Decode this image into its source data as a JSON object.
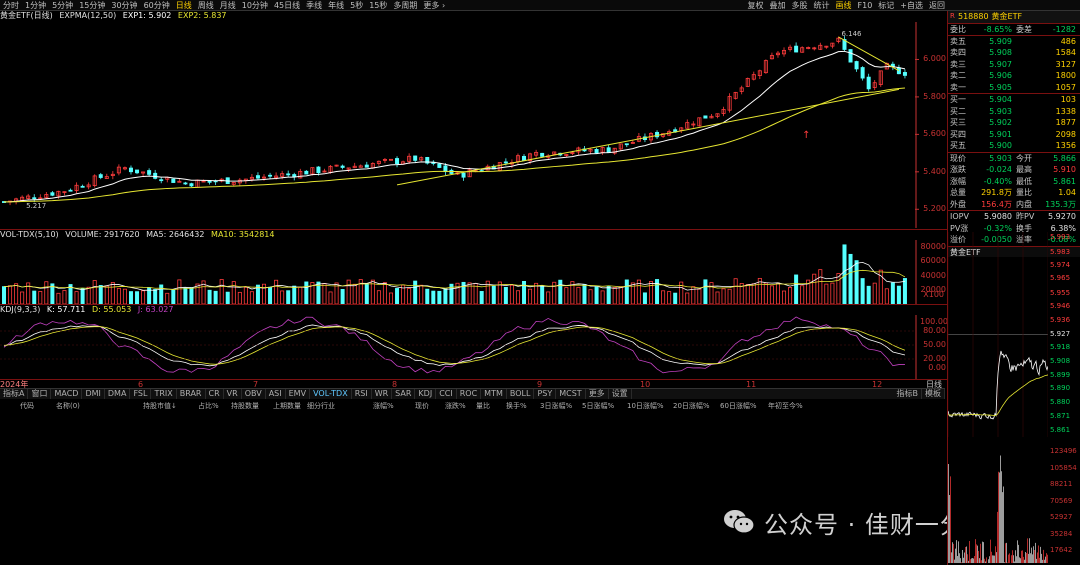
{
  "toolbar": {
    "periods": [
      "分时",
      "1分钟",
      "5分钟",
      "15分钟",
      "30分钟",
      "60分钟",
      "日线",
      "周线",
      "月线",
      "10分钟",
      "45日线",
      "季线",
      "年线",
      "5秒",
      "15秒",
      "多周期",
      "更多 ›"
    ],
    "active_period": "日线",
    "right_tools": [
      "复权",
      "叠加",
      "多股",
      "统计",
      "画线",
      "F10",
      "标记",
      "+自选",
      "返回"
    ]
  },
  "main_chart": {
    "title": "黄金ETF(日线)",
    "indicator": "EXPMA(12,50)",
    "exp1": "EXP1: 5.902",
    "exp2": "EXP2: 5.837",
    "y_ticks": [
      "6.000",
      "5.800",
      "5.600",
      "5.400",
      "5.200"
    ],
    "high_mark": "6.146",
    "low_mark": "5.217"
  },
  "vol_chart": {
    "indicator": "VOL-TDX(5,10)",
    "volume": "VOLUME: 2917620",
    "ma5": "MA5: 2646432",
    "ma10": "MA10: 3542814",
    "y_ticks": [
      "80000",
      "60000",
      "40000",
      "20000"
    ],
    "unit": "X100"
  },
  "kdj_chart": {
    "indicator": "KDJ(9,3,3)",
    "k": "K: 57.711",
    "d": "D: 55.053",
    "j": "J: 63.027",
    "y_ticks": [
      "100.00",
      "80.00",
      "50.00",
      "20.00",
      "0.00"
    ]
  },
  "x_axis": {
    "labels": [
      "2024年",
      "6",
      "7",
      "8",
      "9",
      "10",
      "11",
      "12"
    ],
    "right_label": "日线"
  },
  "tabs": [
    "指标A",
    "窗口",
    "MACD",
    "DMI",
    "DMA",
    "FSL",
    "TRIX",
    "BRAR",
    "CR",
    "VR",
    "OBV",
    "ASI",
    "EMV",
    "VOL-TDX",
    "RSI",
    "WR",
    "SAR",
    "KDJ",
    "CCI",
    "ROC",
    "MTM",
    "BOLL",
    "PSY",
    "MCST",
    "更多",
    "设置"
  ],
  "active_tab": "VOL-TDX",
  "tabs_right": [
    "指标B",
    "模板"
  ],
  "columns": [
    "代码",
    "名称(0)",
    "持股市值↓",
    "占比%",
    "持股数量",
    "上期数量",
    "细分行业",
    "涨幅%",
    "现价",
    "涨跌%",
    "量比",
    "换手%",
    "3日涨幅%",
    "5日涨幅%",
    "10日涨幅%",
    "20日涨幅%",
    "60日涨幅%",
    "年初至今%"
  ],
  "quote": {
    "code": "518880",
    "name": "黄金ETF",
    "weibi_label": "委比",
    "weibi": "-8.65%",
    "weicha_label": "委差",
    "weicha": "-1282",
    "asks": [
      {
        "label": "卖五",
        "price": "5.909",
        "vol": "486"
      },
      {
        "label": "卖四",
        "price": "5.908",
        "vol": "1584"
      },
      {
        "label": "卖三",
        "price": "5.907",
        "vol": "3127"
      },
      {
        "label": "卖二",
        "price": "5.906",
        "vol": "1800"
      },
      {
        "label": "卖一",
        "price": "5.905",
        "vol": "1057"
      }
    ],
    "bids": [
      {
        "label": "买一",
        "price": "5.904",
        "vol": "103"
      },
      {
        "label": "买二",
        "price": "5.903",
        "vol": "1338"
      },
      {
        "label": "买三",
        "price": "5.902",
        "vol": "1877"
      },
      {
        "label": "买四",
        "price": "5.901",
        "vol": "2098"
      },
      {
        "label": "买五",
        "price": "5.900",
        "vol": "1356"
      }
    ],
    "stats": [
      {
        "l1": "现价",
        "v1": "5.903",
        "l2": "今开",
        "v2": "5.866"
      },
      {
        "l1": "涨跌",
        "v1": "-0.024",
        "l2": "最高",
        "v2": "5.910"
      },
      {
        "l1": "涨幅",
        "v1": "-0.40%",
        "l2": "最低",
        "v2": "5.861"
      },
      {
        "l1": "总量",
        "v1": "291.8万",
        "l2": "量比",
        "v2": "1.04"
      },
      {
        "l1": "外盘",
        "v1": "156.4万",
        "l2": "内盘",
        "v2": "135.3万"
      }
    ],
    "extra": [
      {
        "l1": "IOPV",
        "v1": "5.9080",
        "l2": "昨PV",
        "v2": "5.9270"
      },
      {
        "l1": "PV涨",
        "v1": "-0.32%",
        "l2": "换手",
        "v2": "6.38%"
      },
      {
        "l1": "溢价",
        "v1": "-0.0050",
        "l2": "溢率",
        "v2": "-0.08%"
      }
    ],
    "mini_title": "黄金ETF",
    "mini_price_ticks": [
      "5.993",
      "5.983",
      "5.974",
      "5.965",
      "5.955",
      "5.946",
      "5.936",
      "5.927",
      "5.918",
      "5.908",
      "5.899",
      "5.890",
      "5.880",
      "5.871",
      "5.861"
    ],
    "mini_vol_ticks": [
      "123496",
      "105854",
      "88211",
      "70569",
      "52927",
      "35284",
      "17642"
    ]
  },
  "watermark": "公众号 · 佳财一分钟",
  "colors": {
    "up": "#ff3c3c",
    "down": "#54ffff",
    "exp1": "#ffffff",
    "exp2": "#e6e632",
    "k": "#ffffff",
    "d": "#e6e632",
    "j": "#c040c0"
  }
}
